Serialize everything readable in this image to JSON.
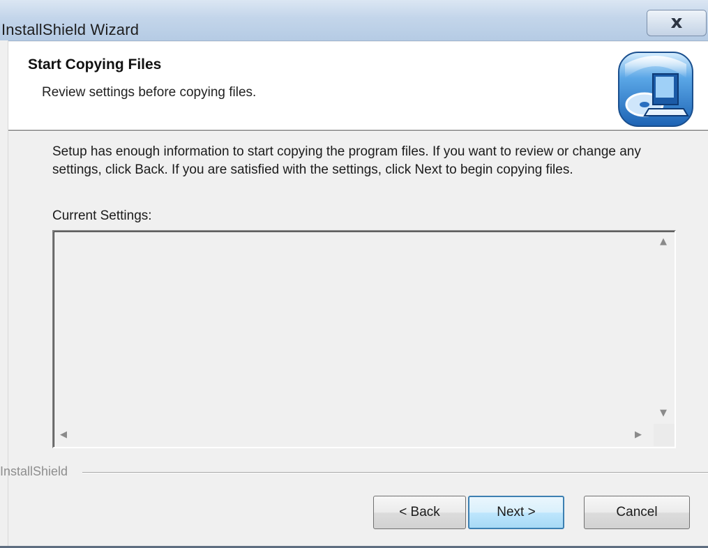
{
  "window": {
    "title": "InstallShield Wizard",
    "close_glyph": "x"
  },
  "header": {
    "title": "Start Copying Files",
    "subtitle": "Review settings before copying files.",
    "icon": "computer-cd-install-icon"
  },
  "body": {
    "description": "Setup has enough information to start copying the program files.  If you want to review or change any settings, click Back.  If you are satisfied with the settings, click Next to begin copying files.",
    "settings_label": "Current Settings:",
    "settings_value": ""
  },
  "footer": {
    "brand": "InstallShield",
    "buttons": {
      "back": "< Back",
      "next": "Next >",
      "cancel": "Cancel"
    }
  },
  "colors": {
    "titlebar": "#c3d5ea",
    "dialog_bg": "#f0f0f0",
    "header_bg": "#ffffff",
    "default_button_border": "#3c7fb1"
  }
}
